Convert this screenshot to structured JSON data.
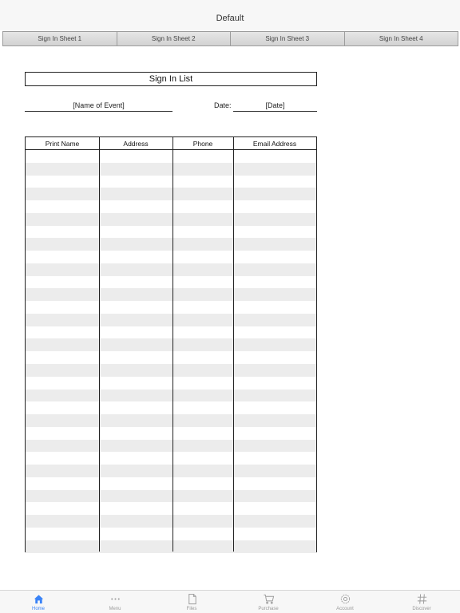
{
  "nav": {
    "title": "Default"
  },
  "sheets": [
    {
      "label": "Sign In Sheet 1"
    },
    {
      "label": "Sign In Sheet 2"
    },
    {
      "label": "Sign In Sheet 3"
    },
    {
      "label": "Sign In Sheet 4"
    }
  ],
  "document": {
    "title": "Sign In List",
    "event_name": "[Name of Event]",
    "date_label": "Date:",
    "date_value": "[Date]",
    "columns": [
      "Print Name",
      "Address",
      "Phone",
      "Email Address"
    ],
    "row_count": 32
  },
  "tabs": [
    {
      "label": "Home",
      "icon": "home-icon",
      "active": true
    },
    {
      "label": "Menu",
      "icon": "ellipsis-icon",
      "active": false
    },
    {
      "label": "Files",
      "icon": "file-icon",
      "active": false
    },
    {
      "label": "Purchase",
      "icon": "cart-icon",
      "active": false
    },
    {
      "label": "Account",
      "icon": "gear-icon",
      "active": false
    },
    {
      "label": "Discover",
      "icon": "hash-icon",
      "active": false
    }
  ],
  "colors": {
    "accent": "#3a83f7",
    "inactive": "#9a9a9a",
    "row_stripe": "#ececec"
  }
}
